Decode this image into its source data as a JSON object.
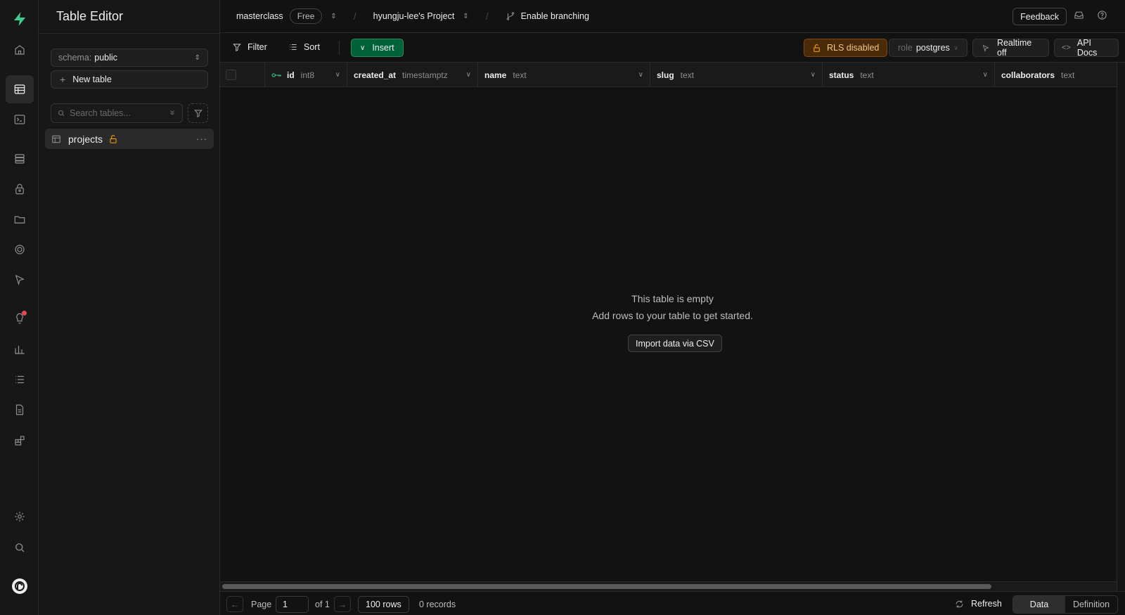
{
  "sidebar": {
    "title": "Table Editor",
    "schema_label": "schema:",
    "schema_value": "public",
    "new_table_label": "New table",
    "search_placeholder": "Search tables...",
    "tables": [
      {
        "name": "projects"
      }
    ]
  },
  "topbar": {
    "org": "masterclass",
    "plan": "Free",
    "project": "hyungju-lee's Project",
    "branching": "Enable branching",
    "feedback": "Feedback"
  },
  "toolbar": {
    "filter": "Filter",
    "sort": "Sort",
    "insert": "Insert",
    "rls": "RLS disabled",
    "role_label": "role",
    "role_value": "postgres",
    "realtime": "Realtime off",
    "api_docs": "API Docs"
  },
  "columns": [
    {
      "name": "id",
      "type": "int8"
    },
    {
      "name": "created_at",
      "type": "timestamptz"
    },
    {
      "name": "name",
      "type": "text"
    },
    {
      "name": "slug",
      "type": "text"
    },
    {
      "name": "status",
      "type": "text"
    },
    {
      "name": "collaborators",
      "type": "text"
    }
  ],
  "empty_state": {
    "title": "This table is empty",
    "subtitle": "Add rows to your table to get started.",
    "import_button": "Import data via CSV"
  },
  "footer": {
    "page_label": "Page",
    "page_value": "1",
    "of_label": "of 1",
    "rows_label": "100 rows",
    "records": "0 records",
    "refresh": "Refresh",
    "tab_data": "Data",
    "tab_definition": "Definition"
  },
  "colors": {
    "accent": "#3ecf8e",
    "insert_bg": "#006239",
    "rls_warning": "#f1a10d",
    "background": "#121212"
  }
}
